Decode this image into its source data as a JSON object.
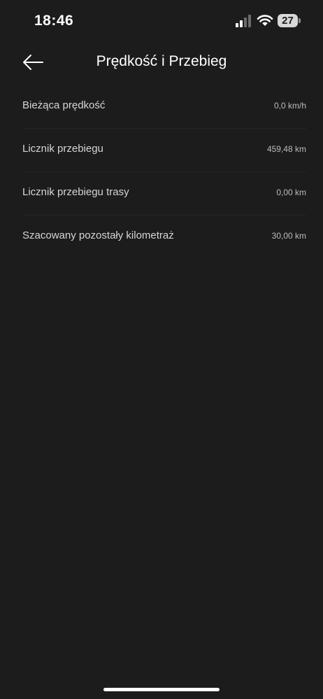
{
  "status_bar": {
    "time": "18:46",
    "battery_level": "27"
  },
  "header": {
    "title": "Prędkość i Przebieg"
  },
  "rows": [
    {
      "label": "Bieżąca prędkość",
      "value": "0,0 km/h"
    },
    {
      "label": "Licznik przebiegu",
      "value": "459,48 km"
    },
    {
      "label": "Licznik przebiegu trasy",
      "value": "0,00 km"
    },
    {
      "label": "Szacowany pozostały kilometraż",
      "value": "30,00 km"
    }
  ],
  "colors": {
    "background": "#1c1c1d",
    "text": "#ffffff",
    "secondary_text": "#bdbdbd"
  }
}
